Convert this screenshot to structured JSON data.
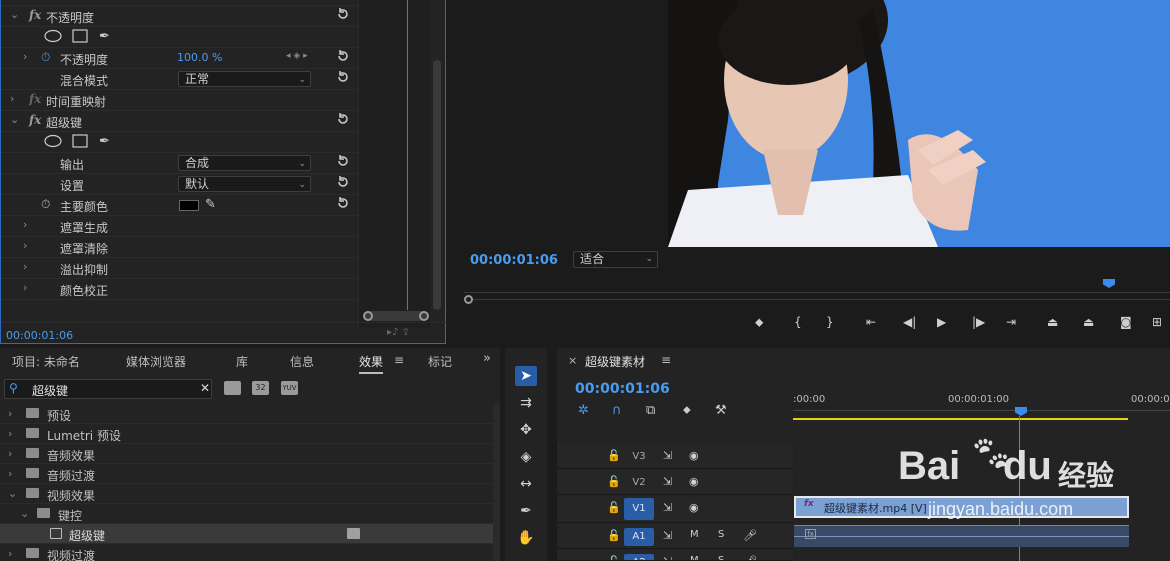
{
  "effect_controls": {
    "rows": {
      "opacity_section": "不透明度",
      "opacity_param": "不透明度",
      "opacity_value": "100.0 %",
      "blend_mode_label": "混合模式",
      "blend_mode_value": "正常",
      "time_remap": "时间重映射",
      "ultra_key": "超级键",
      "output_label": "输出",
      "output_value": "合成",
      "setting_label": "设置",
      "setting_value": "默认",
      "key_color_label": "主要颜色",
      "matte_gen": "遮罩生成",
      "matte_cleanup": "遮罩清除",
      "spill_suppress": "溢出抑制",
      "color_correct": "颜色校正"
    },
    "timecode": "00:00:01:06"
  },
  "program_monitor": {
    "timecode": "00:00:01:06",
    "fit_value": "适合"
  },
  "project_panel": {
    "tabs": [
      "项目: 未命名",
      "媒体浏览器",
      "库",
      "信息",
      "效果",
      "标记"
    ],
    "active_tab": "效果",
    "search_value": "超级键",
    "tree": [
      "预设",
      "Lumetri 预设",
      "音频效果",
      "音频过渡",
      "视频效果",
      "键控",
      "超级键",
      "视频过渡"
    ]
  },
  "timeline": {
    "sequence_name": "超级键素材",
    "timecode": "00:00:01:06",
    "ruler": [
      ":00:00",
      "00:00:01:00",
      "00:00:0"
    ],
    "tracks": [
      "V3",
      "V2",
      "V1",
      "A1",
      "A2"
    ],
    "track_buttons": {
      "mute": "M",
      "solo": "S"
    },
    "clip_name": "超级键素材.mp4 [V]"
  },
  "watermark": {
    "brand": "Bai",
    "brand2": "du",
    "jingyan": "经验",
    "url": "jingyan.baidu.com"
  },
  "colors": {
    "accent": "#4a9cf0",
    "video_bg": "#3d84de",
    "clip": "#7aa0d4"
  }
}
